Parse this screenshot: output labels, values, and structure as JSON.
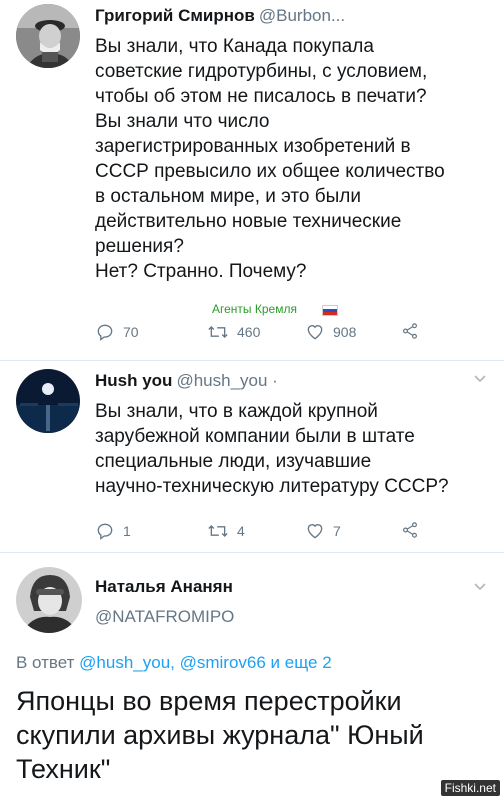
{
  "tweet1": {
    "name": "Григорий Смирнов",
    "handle": "@Burbon...",
    "lines": [
      "Вы знали, что Канада покупала",
      "советские гидротурбины, с условием,",
      "чтобы об этом не писалось в печати?",
      "Вы знали что число",
      "зарегистрированных изобретений в",
      "СССР превысило их общее количество",
      "в остальном мире, и это были",
      "действительно новые технические",
      "решения?",
      "Нет? Странно. Почему?"
    ],
    "overlay": "Агенты Кремля",
    "replies": "70",
    "retweets": "460",
    "likes": "908"
  },
  "tweet2": {
    "name": "Hush you",
    "handle": "@hush_you ·",
    "lines": [
      "Вы знали, что в каждой крупной",
      "зарубежной компании были в штате",
      "специальные люди, изучавшие",
      "научно-техническую литературу СССР?"
    ],
    "replies": "1",
    "retweets": "4",
    "likes": "7"
  },
  "tweet3": {
    "name": "Наталья Ананян",
    "handle": "@NATAFROMIPO",
    "reply_prefix": "В ответ ",
    "reply_targets": "@hush_you, @smirov66",
    "reply_suffix": " и еще 2",
    "lines": [
      "Японцы во время перестройки",
      "скупили архивы журнала\" Юный",
      "Техник\""
    ]
  },
  "watermark": "Fishki.net",
  "colors": {
    "accent": "#1da1f2",
    "muted": "#657786",
    "border": "#e1e8ed"
  }
}
